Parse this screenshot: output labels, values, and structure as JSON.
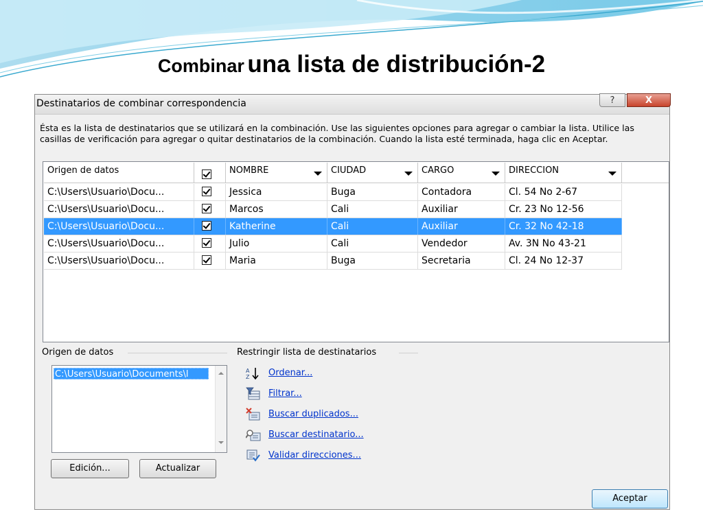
{
  "slide": {
    "title_part1": "Combinar",
    "title_part2": "una lista de distribución-2"
  },
  "dialog": {
    "title": "Destinatarios de combinar correspondencia",
    "help_label": "?",
    "close_label": "X",
    "instructions": "Ésta es la lista de destinatarios que se utilizará en la combinación. Use las siguientes opciones para agregar o cambiar la lista. Utilice las casillas de verificación para agregar o quitar destinatarios de la combinación. Cuando la lista esté terminada, haga clic en Aceptar."
  },
  "table": {
    "columns": [
      "Origen de datos",
      "",
      "NOMBRE",
      "CIUDAD",
      "CARGO",
      "DIRECCION"
    ],
    "rows": [
      {
        "origin": "C:\\Users\\Usuario\\Docu...",
        "checked": true,
        "nombre": "Jessica",
        "ciudad": "Buga",
        "cargo": "Contadora",
        "direccion": "Cl. 54 No 2-67"
      },
      {
        "origin": "C:\\Users\\Usuario\\Docu...",
        "checked": true,
        "nombre": "Marcos",
        "ciudad": "Cali",
        "cargo": "Auxiliar",
        "direccion": "Cr. 23 No 12-56"
      },
      {
        "origin": "C:\\Users\\Usuario\\Docu...",
        "checked": true,
        "nombre": "Katherine",
        "ciudad": "Cali",
        "cargo": "Auxiliar",
        "direccion": "Cr. 32 No 42-18"
      },
      {
        "origin": "C:\\Users\\Usuario\\Docu...",
        "checked": true,
        "nombre": "Julio",
        "ciudad": "Cali",
        "cargo": "Vendedor",
        "direccion": "Av. 3N No 43-21"
      },
      {
        "origin": "C:\\Users\\Usuario\\Docu...",
        "checked": true,
        "nombre": "Maria",
        "ciudad": "Buga",
        "cargo": "Secretaria",
        "direccion": "Cl. 24 No 12-37"
      }
    ],
    "selected_row_index": 2
  },
  "data_source": {
    "label": "Origen de datos",
    "selected_item": "C:\\Users\\Usuario\\Documents\\l",
    "edit_button": "Edición...",
    "refresh_button": "Actualizar"
  },
  "restrict": {
    "label": "Restringir lista de destinatarios",
    "actions": [
      {
        "label": "Ordenar...",
        "icon": "sort-az-icon"
      },
      {
        "label": "Filtrar...",
        "icon": "filter-icon"
      },
      {
        "label": "Buscar duplicados...",
        "icon": "find-duplicates-icon"
      },
      {
        "label": "Buscar destinatario...",
        "icon": "find-recipient-icon"
      },
      {
        "label": "Validar direcciones...",
        "icon": "validate-addresses-icon"
      }
    ]
  },
  "ok_button": "Aceptar",
  "colors": {
    "selection": "#3399ff",
    "link": "#0033cc",
    "dialog_bg": "#f0f0f0",
    "close_button": "#c8442c"
  }
}
